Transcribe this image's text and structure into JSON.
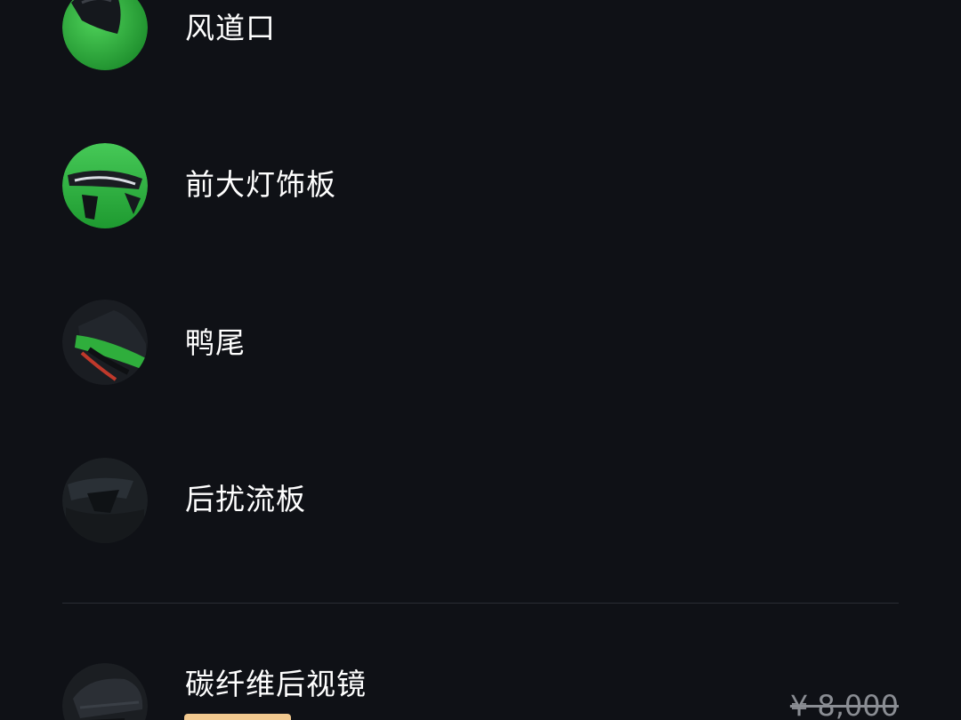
{
  "items": [
    {
      "label": "风道口",
      "thumbnail": "green-car-wind-vent-image"
    },
    {
      "label": "前大灯饰板",
      "thumbnail": "green-car-headlight-trim-image"
    },
    {
      "label": "鸭尾",
      "thumbnail": "green-car-duck-tail-image"
    },
    {
      "label": "后扰流板",
      "thumbnail": "rear-spoiler-image"
    }
  ],
  "featured": {
    "label": "碳纤维后视镜",
    "original_price": "¥ 8,000",
    "thumbnail": "carbon-fiber-mirror-image"
  },
  "colors": {
    "background": "#0f1116",
    "text": "#ffffff",
    "muted": "#8a8d93",
    "accent_green": "#2fae3c",
    "tag": "#f2c98f"
  }
}
